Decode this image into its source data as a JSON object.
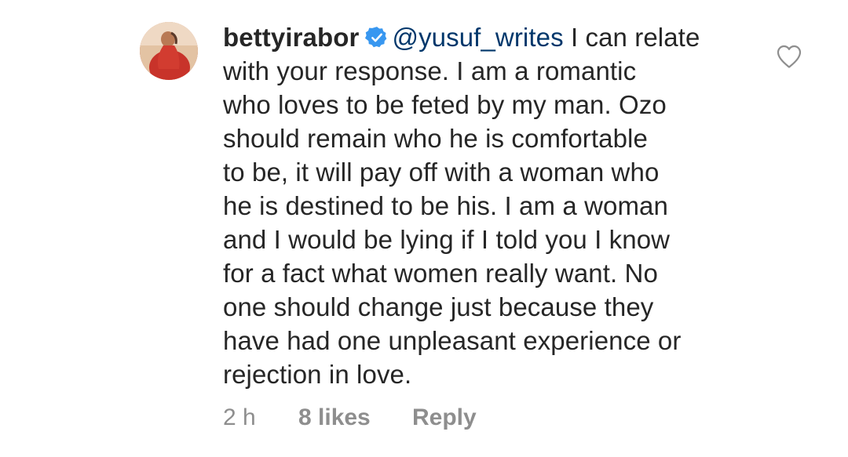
{
  "comment": {
    "username": "bettyirabor",
    "verified_icon": "verified-badge-icon",
    "mention": "@yusuf_writes",
    "lines": [
      " I can relate",
      "with your response. I am a romantic",
      "who loves to be feted by my man. Ozo",
      "should remain who he is comfortable",
      "to be, it will pay off with a woman who",
      "he is destined to be his. I am a woman",
      "and I would be lying if I told you I know",
      "for a fact what women really want. No",
      "one should change just because they",
      "have had one unpleasant experience  or",
      "rejection in love."
    ],
    "time": "2 h",
    "likes": "8 likes",
    "reply_label": "Reply",
    "like_icon": "heart-outline-icon"
  },
  "colors": {
    "text": "#262626",
    "mention": "#00376b",
    "secondary": "#8e8e8e",
    "verified": "#3897f0"
  }
}
